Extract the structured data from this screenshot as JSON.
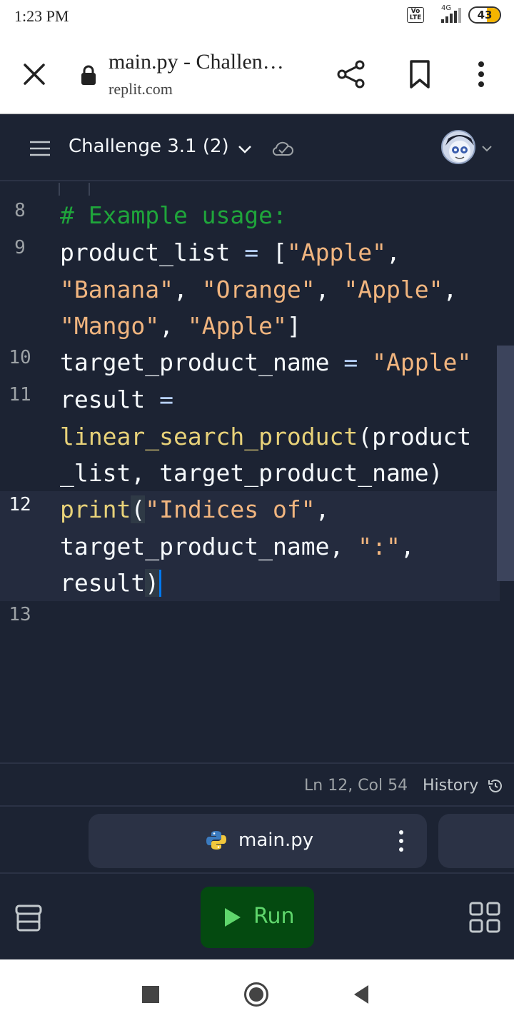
{
  "status_bar": {
    "time": "1:23 PM",
    "network": "4G",
    "volte": "Vo LTE",
    "battery": "43"
  },
  "browser": {
    "page_title": "main.py - Challen…",
    "url": "replit.com",
    "icons": [
      "close-icon",
      "lock-icon",
      "share-icon",
      "bookmark-icon",
      "more-vert-icon"
    ]
  },
  "header": {
    "project_name": "Challenge 3.1 (2)",
    "icons": [
      "menu-icon",
      "chevron-down-icon",
      "cloud-check-icon",
      "avatar",
      "chevron-down-icon"
    ]
  },
  "editor": {
    "lines": [
      {
        "number": "8",
        "text": "# Example usage:"
      },
      {
        "number": "9",
        "text": "product_list = [\"Apple\", \"Banana\", \"Orange\", \"Apple\", \"Mango\", \"Apple\"]"
      },
      {
        "number": "10",
        "text": "target_product_name = \"Apple\""
      },
      {
        "number": "11",
        "text": "result = linear_search_product(product_list, target_product_name)"
      },
      {
        "number": "12",
        "text": "print(\"Indices of\", target_product_name, \":\", result)"
      },
      {
        "number": "13",
        "text": ""
      }
    ],
    "active_line": "12"
  },
  "status": {
    "cursor_position": "Ln 12, Col 54",
    "history_label": "History"
  },
  "tabs": [
    {
      "label": "main.py",
      "icon": "python-icon"
    }
  ],
  "toolbar": {
    "run_label": "Run",
    "colors": {
      "run_bg": "#044a10",
      "run_text": "#5fd66c"
    }
  },
  "colors": {
    "editor_bg": "#1c2333",
    "comment": "#1fa53b",
    "string": "#f1b57f",
    "function": "#e8d279",
    "cursor": "#0079f2"
  }
}
